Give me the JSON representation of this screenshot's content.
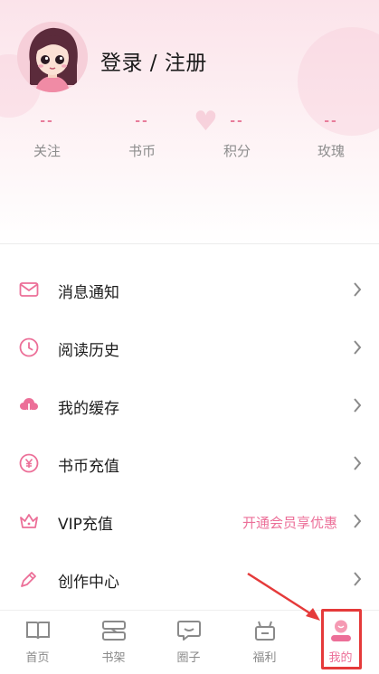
{
  "header": {
    "login_label": "登录 / 注册",
    "stats": [
      {
        "value": "--",
        "label": "关注"
      },
      {
        "value": "--",
        "label": "书币"
      },
      {
        "value": "--",
        "label": "积分"
      },
      {
        "value": "--",
        "label": "玫瑰"
      }
    ]
  },
  "menu": {
    "items": [
      {
        "icon": "envelope-icon",
        "label": "消息通知",
        "extra": ""
      },
      {
        "icon": "clock-icon",
        "label": "阅读历史",
        "extra": ""
      },
      {
        "icon": "cloud-download-icon",
        "label": "我的缓存",
        "extra": ""
      },
      {
        "icon": "coin-icon",
        "label": "书币充值",
        "extra": ""
      },
      {
        "icon": "crown-icon",
        "label": "VIP充值",
        "extra": "开通会员享优惠"
      },
      {
        "icon": "pen-icon",
        "label": "创作中心",
        "extra": ""
      }
    ]
  },
  "tabbar": {
    "tabs": [
      {
        "icon": "book-icon",
        "label": "首页",
        "active": false
      },
      {
        "icon": "bookshelf-icon",
        "label": "书架",
        "active": false
      },
      {
        "icon": "chat-bubble-icon",
        "label": "圈子",
        "active": false
      },
      {
        "icon": "gift-icon",
        "label": "福利",
        "active": false
      },
      {
        "icon": "profile-icon",
        "label": "我的",
        "active": true
      }
    ]
  },
  "colors": {
    "accent": "#ec6f98",
    "highlight": "#e53a3a",
    "header_bg": "#fbe3ea"
  }
}
